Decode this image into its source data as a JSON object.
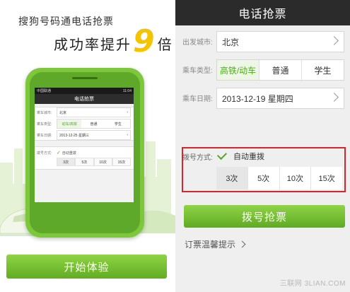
{
  "promo": {
    "line1": "搜狗号码通电话抢票",
    "line2_prefix": "成功率提升",
    "line2_number": "9",
    "line2_suffix": "倍",
    "start_button": "开始体验"
  },
  "mini": {
    "status_left": "中国联通",
    "status_right": "11:04",
    "title": "电话抢票",
    "city_label": "乘车城市:",
    "city_value": "北京",
    "type_label": "乘车类型:",
    "types": [
      "动车/高铁",
      "普通",
      "学生"
    ],
    "date_label": "乘车日期:",
    "date_value": "2013-12-25 星期三",
    "dial_label": "拨号方式:",
    "auto_redial": "自动重拨",
    "counts": [
      "3次",
      "5次",
      "10次",
      "15次"
    ]
  },
  "app": {
    "title": "电话抢票",
    "city_label": "出发城市:",
    "city_value": "北京",
    "type_label": "乘车类型:",
    "types": [
      "高铁/动车",
      "普通",
      "学生"
    ],
    "date_label": "乘车日期:",
    "date_value": "2013-12-19 星期四",
    "dial_label": "拨号方式:",
    "auto_redial": "自动重拨",
    "counts": [
      "3次",
      "5次",
      "10次",
      "15次"
    ],
    "dial_button": "拨号抢票",
    "tips": "订票温馨提示"
  },
  "watermark": "三联网 3LIAN.COM",
  "colors": {
    "accent_green": "#62ac24",
    "title_bar": "#2b2b2b",
    "highlight_red": "#d6262b",
    "promo_yellow": "#f5c400"
  }
}
